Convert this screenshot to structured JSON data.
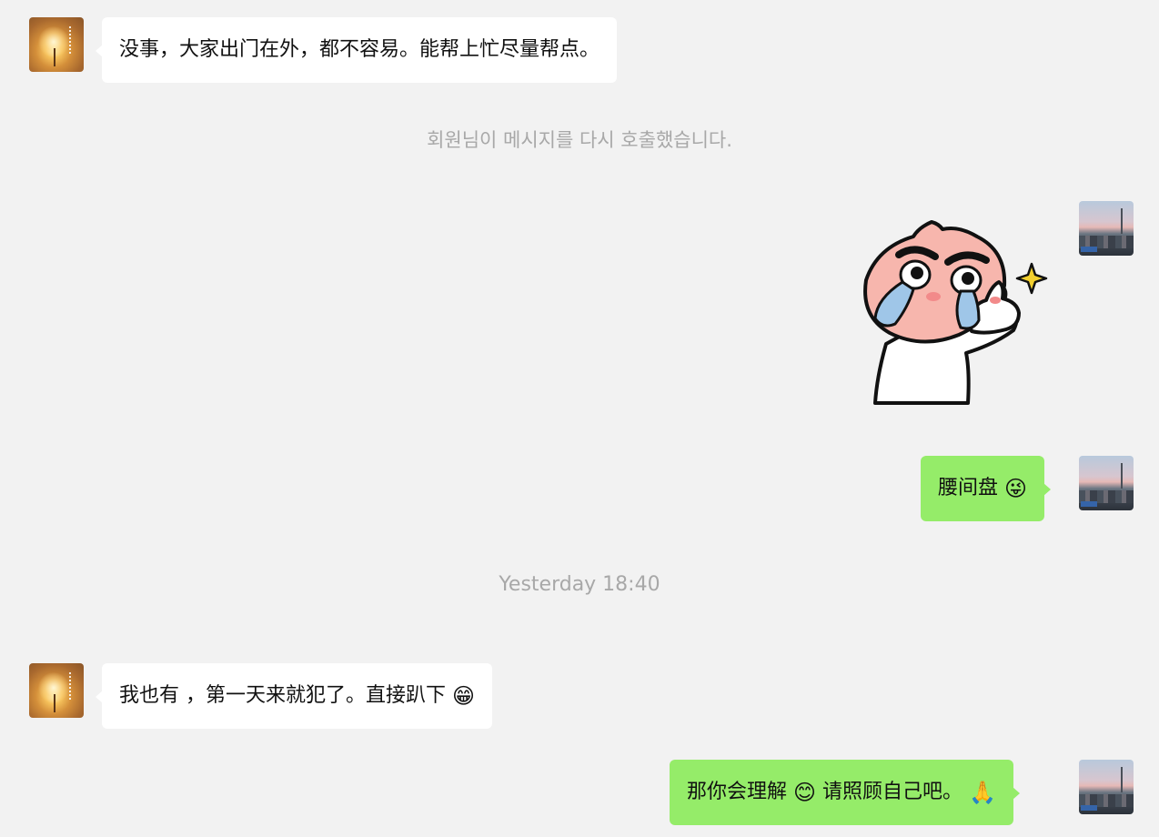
{
  "messages": [
    {
      "sender": "contact",
      "text": "没事，大家出门在外，都不容易。能帮上忙尽量帮点。"
    },
    {
      "system": "회원님이 메시지를 다시 호출했습니다."
    },
    {
      "sender": "me",
      "sticker": "peach-crying-thumbs-up-sticker"
    },
    {
      "sender": "me",
      "text": "腰间盘",
      "emoji": "😜"
    },
    {
      "timestamp": "Yesterday 18:40"
    },
    {
      "sender": "contact",
      "text": "我也有 ，第一天来就犯了。直接趴下",
      "emoji": "😁"
    },
    {
      "sender": "me",
      "text_part1": "那你会理解",
      "emoji1": "😊",
      "text_part2": "请照顾自己吧。",
      "emoji2": "🙏"
    }
  ],
  "colors": {
    "background": "#f2f2f2",
    "incoming_bubble": "#ffffff",
    "outgoing_bubble": "#95ec69",
    "system_text": "#a8a8a8"
  }
}
